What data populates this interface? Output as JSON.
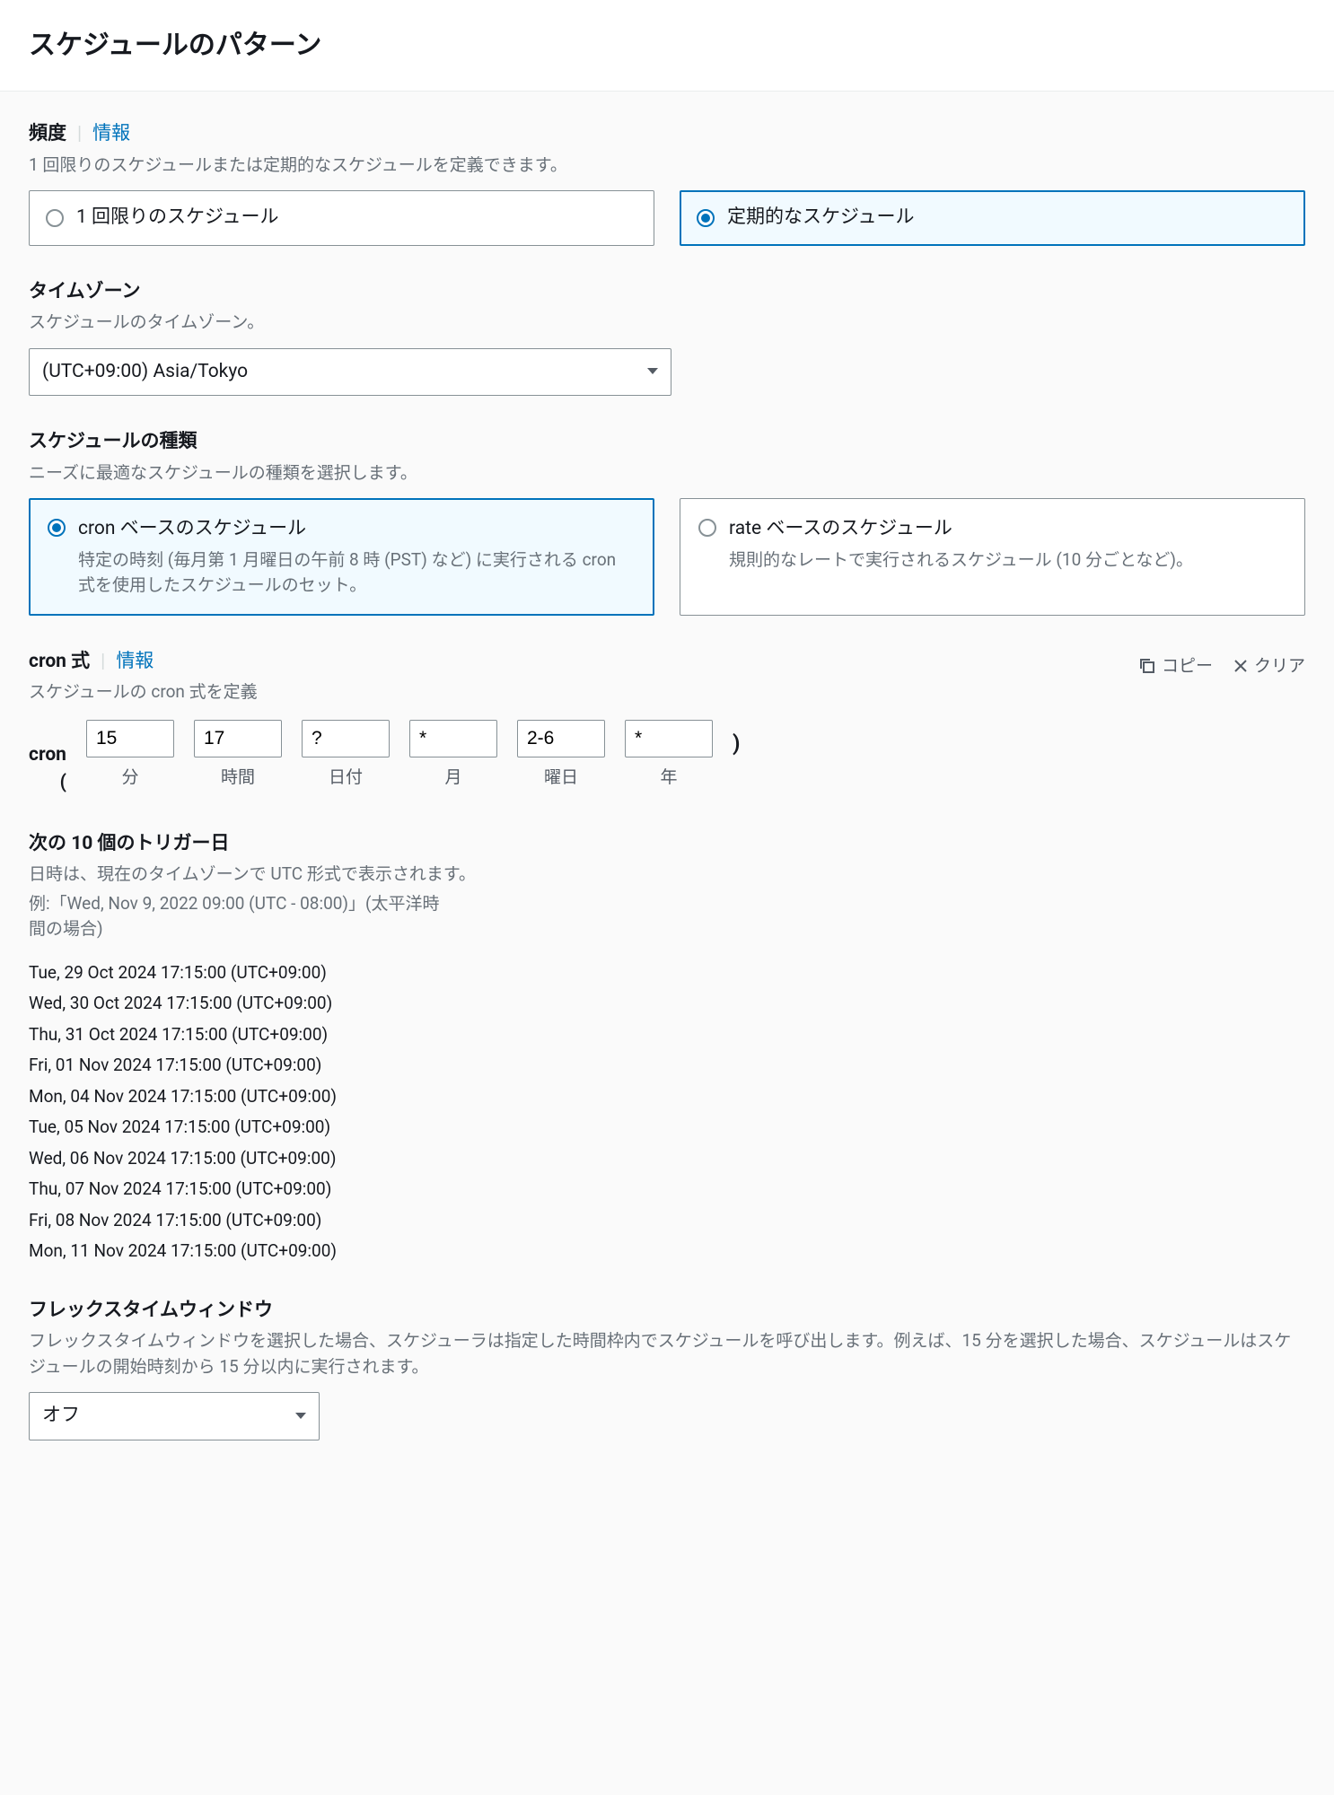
{
  "header": {
    "title": "スケジュールのパターン"
  },
  "frequency": {
    "label": "頻度",
    "infoLabel": "情報",
    "helper": "1 回限りのスケジュールまたは定期的なスケジュールを定義できます。",
    "optionOneTime": "1 回限りのスケジュール",
    "optionRecurring": "定期的なスケジュール"
  },
  "timezone": {
    "label": "タイムゾーン",
    "helper": "スケジュールのタイムゾーン。",
    "value": "(UTC+09:00) Asia/Tokyo"
  },
  "scheduleType": {
    "label": "スケジュールの種類",
    "helper": "ニーズに最適なスケジュールの種類を選択します。",
    "cronTitle": "cron ベースのスケジュール",
    "cronDesc": "特定の時刻 (毎月第 1 月曜日の午前 8 時 (PST) など) に実行される cron 式を使用したスケジュールのセット。",
    "rateTitle": "rate ベースのスケジュール",
    "rateDesc": "規則的なレートで実行されるスケジュール (10 分ごとなど)。"
  },
  "cron": {
    "label": "cron 式",
    "infoLabel": "情報",
    "helper": "スケジュールの cron 式を定義",
    "copyLabel": "コピー",
    "clearLabel": "クリア",
    "prefix": "cron (",
    "suffix": ")",
    "fields": {
      "minute": {
        "value": "15",
        "unit": "分"
      },
      "hour": {
        "value": "17",
        "unit": "時間"
      },
      "dayOfMonth": {
        "value": "?",
        "unit": "日付"
      },
      "month": {
        "value": "*",
        "unit": "月"
      },
      "dayOfWeek": {
        "value": "2-6",
        "unit": "曜日"
      },
      "year": {
        "value": "*",
        "unit": "年"
      }
    }
  },
  "triggers": {
    "label": "次の 10 個のトリガー日",
    "helper1": "日時は、現在のタイムゾーンで UTC 形式で表示されます。",
    "helper2": "例:「Wed, Nov 9, 2022 09:00 (UTC - 08:00)」(太平洋時間の場合)",
    "items": [
      "Tue, 29 Oct 2024 17:15:00 (UTC+09:00)",
      "Wed, 30 Oct 2024 17:15:00 (UTC+09:00)",
      "Thu, 31 Oct 2024 17:15:00 (UTC+09:00)",
      "Fri, 01 Nov 2024 17:15:00 (UTC+09:00)",
      "Mon, 04 Nov 2024 17:15:00 (UTC+09:00)",
      "Tue, 05 Nov 2024 17:15:00 (UTC+09:00)",
      "Wed, 06 Nov 2024 17:15:00 (UTC+09:00)",
      "Thu, 07 Nov 2024 17:15:00 (UTC+09:00)",
      "Fri, 08 Nov 2024 17:15:00 (UTC+09:00)",
      "Mon, 11 Nov 2024 17:15:00 (UTC+09:00)"
    ]
  },
  "flexWindow": {
    "label": "フレックスタイムウィンドウ",
    "helper": "フレックスタイムウィンドウを選択した場合、スケジューラは指定した時間枠内でスケジュールを呼び出します。例えば、15 分を選択した場合、スケジュールはスケジュールの開始時刻から 15 分以内に実行されます。",
    "value": "オフ"
  }
}
